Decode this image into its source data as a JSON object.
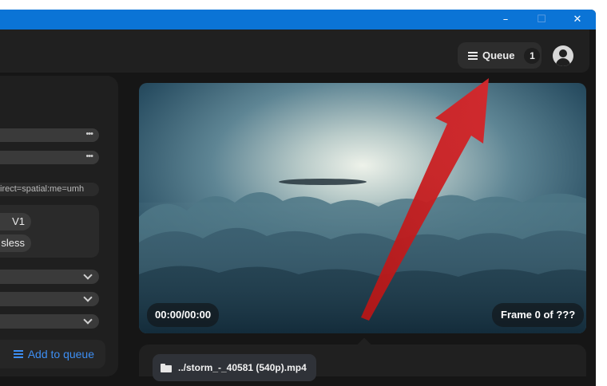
{
  "window": {
    "controls": {
      "minimize": "–",
      "maximize": "☐",
      "close": "✕"
    }
  },
  "header": {
    "queue_label": "Queue",
    "queue_count": "1"
  },
  "settings": {
    "field_3_text": "irect=spatial:me=umh",
    "chip_1": "V1",
    "chip_2": "sless",
    "add_to_queue_label": "Add to queue"
  },
  "preview": {
    "timecode": "00:00/00:00",
    "frame_info": "Frame 0 of ???"
  },
  "file": {
    "name": "../storm_-_40581 (540p).mp4"
  },
  "colors": {
    "titlebar": "#0b74d6",
    "accent": "#3d8ef2",
    "annotation_arrow": "#c81e1e"
  }
}
